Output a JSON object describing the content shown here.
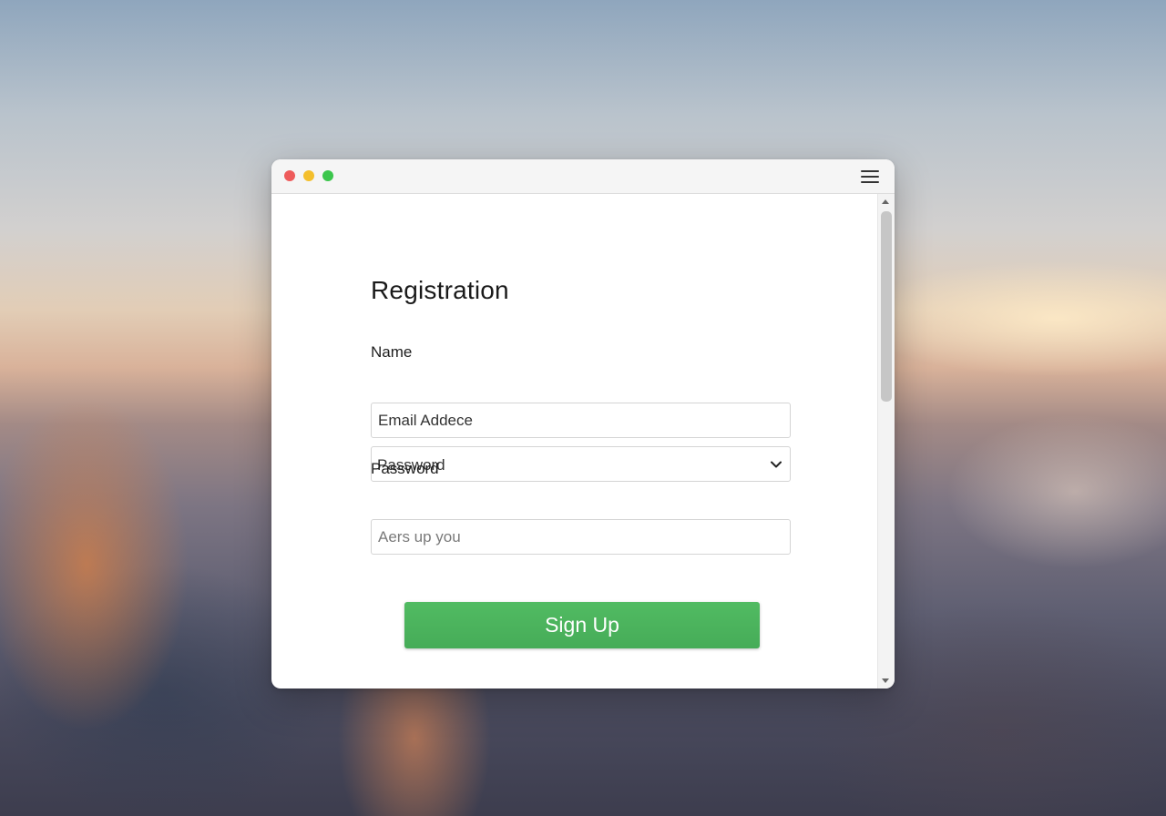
{
  "form": {
    "title": "Registration",
    "name_label": "Name",
    "email_value": "Email Addece",
    "select_value": "Password",
    "password_label": "Password",
    "password_placeholder": "Aers up you",
    "submit_label": "Sign Up"
  },
  "icons": {
    "window_close": "red-circle",
    "window_minimize": "yellow-circle",
    "window_maximize": "green-circle",
    "menu": "hamburger-menu-icon",
    "select_chevron": "chevron-down-icon",
    "scroll_up": "triangle-up",
    "scroll_down": "triangle-down"
  },
  "colors": {
    "primary_button": "#4cb45d",
    "window_close": "#ee5b5b",
    "window_minimize": "#f4bf2c",
    "window_maximize": "#3cc64c"
  }
}
